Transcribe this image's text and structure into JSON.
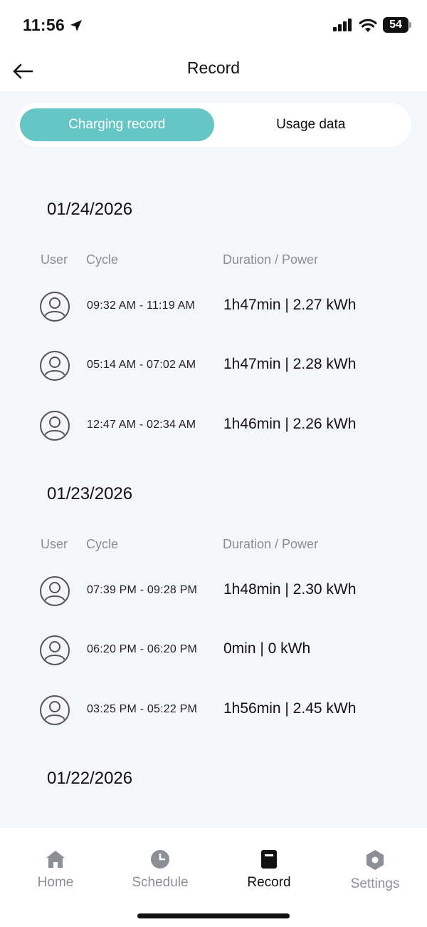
{
  "status_bar": {
    "time": "11:56",
    "battery": "54"
  },
  "header": {
    "title": "Record"
  },
  "tabs": [
    {
      "label": "Charging record",
      "active": true
    },
    {
      "label": "Usage data",
      "active": false
    }
  ],
  "columns": {
    "user": "User",
    "cycle": "Cycle",
    "duration": "Duration / Power"
  },
  "sections": [
    {
      "date": "01/24/2026",
      "records": [
        {
          "cycle": "09:32 AM - 11:19 AM",
          "duration": "1h47min | 2.27 kWh"
        },
        {
          "cycle": "05:14 AM - 07:02 AM",
          "duration": "1h47min | 2.28 kWh"
        },
        {
          "cycle": "12:47 AM - 02:34 AM",
          "duration": "1h46min | 2.26 kWh"
        }
      ]
    },
    {
      "date": "01/23/2026",
      "records": [
        {
          "cycle": "07:39 PM - 09:28 PM",
          "duration": "1h48min | 2.30 kWh"
        },
        {
          "cycle": "06:20 PM - 06:20 PM",
          "duration": "0min | 0 kWh"
        },
        {
          "cycle": "03:25 PM - 05:22 PM",
          "duration": "1h56min | 2.45 kWh"
        }
      ]
    },
    {
      "date": "01/22/2026",
      "records": []
    }
  ],
  "nav": [
    {
      "label": "Home",
      "icon": "home-icon",
      "active": false
    },
    {
      "label": "Schedule",
      "icon": "clock-icon",
      "active": false
    },
    {
      "label": "Record",
      "icon": "record-icon",
      "active": true
    },
    {
      "label": "Settings",
      "icon": "settings-hex-icon",
      "active": false
    }
  ],
  "colors": {
    "accent": "#66c6c6",
    "nav_inactive": "#8c8f96",
    "background": "#f5f6fa"
  }
}
